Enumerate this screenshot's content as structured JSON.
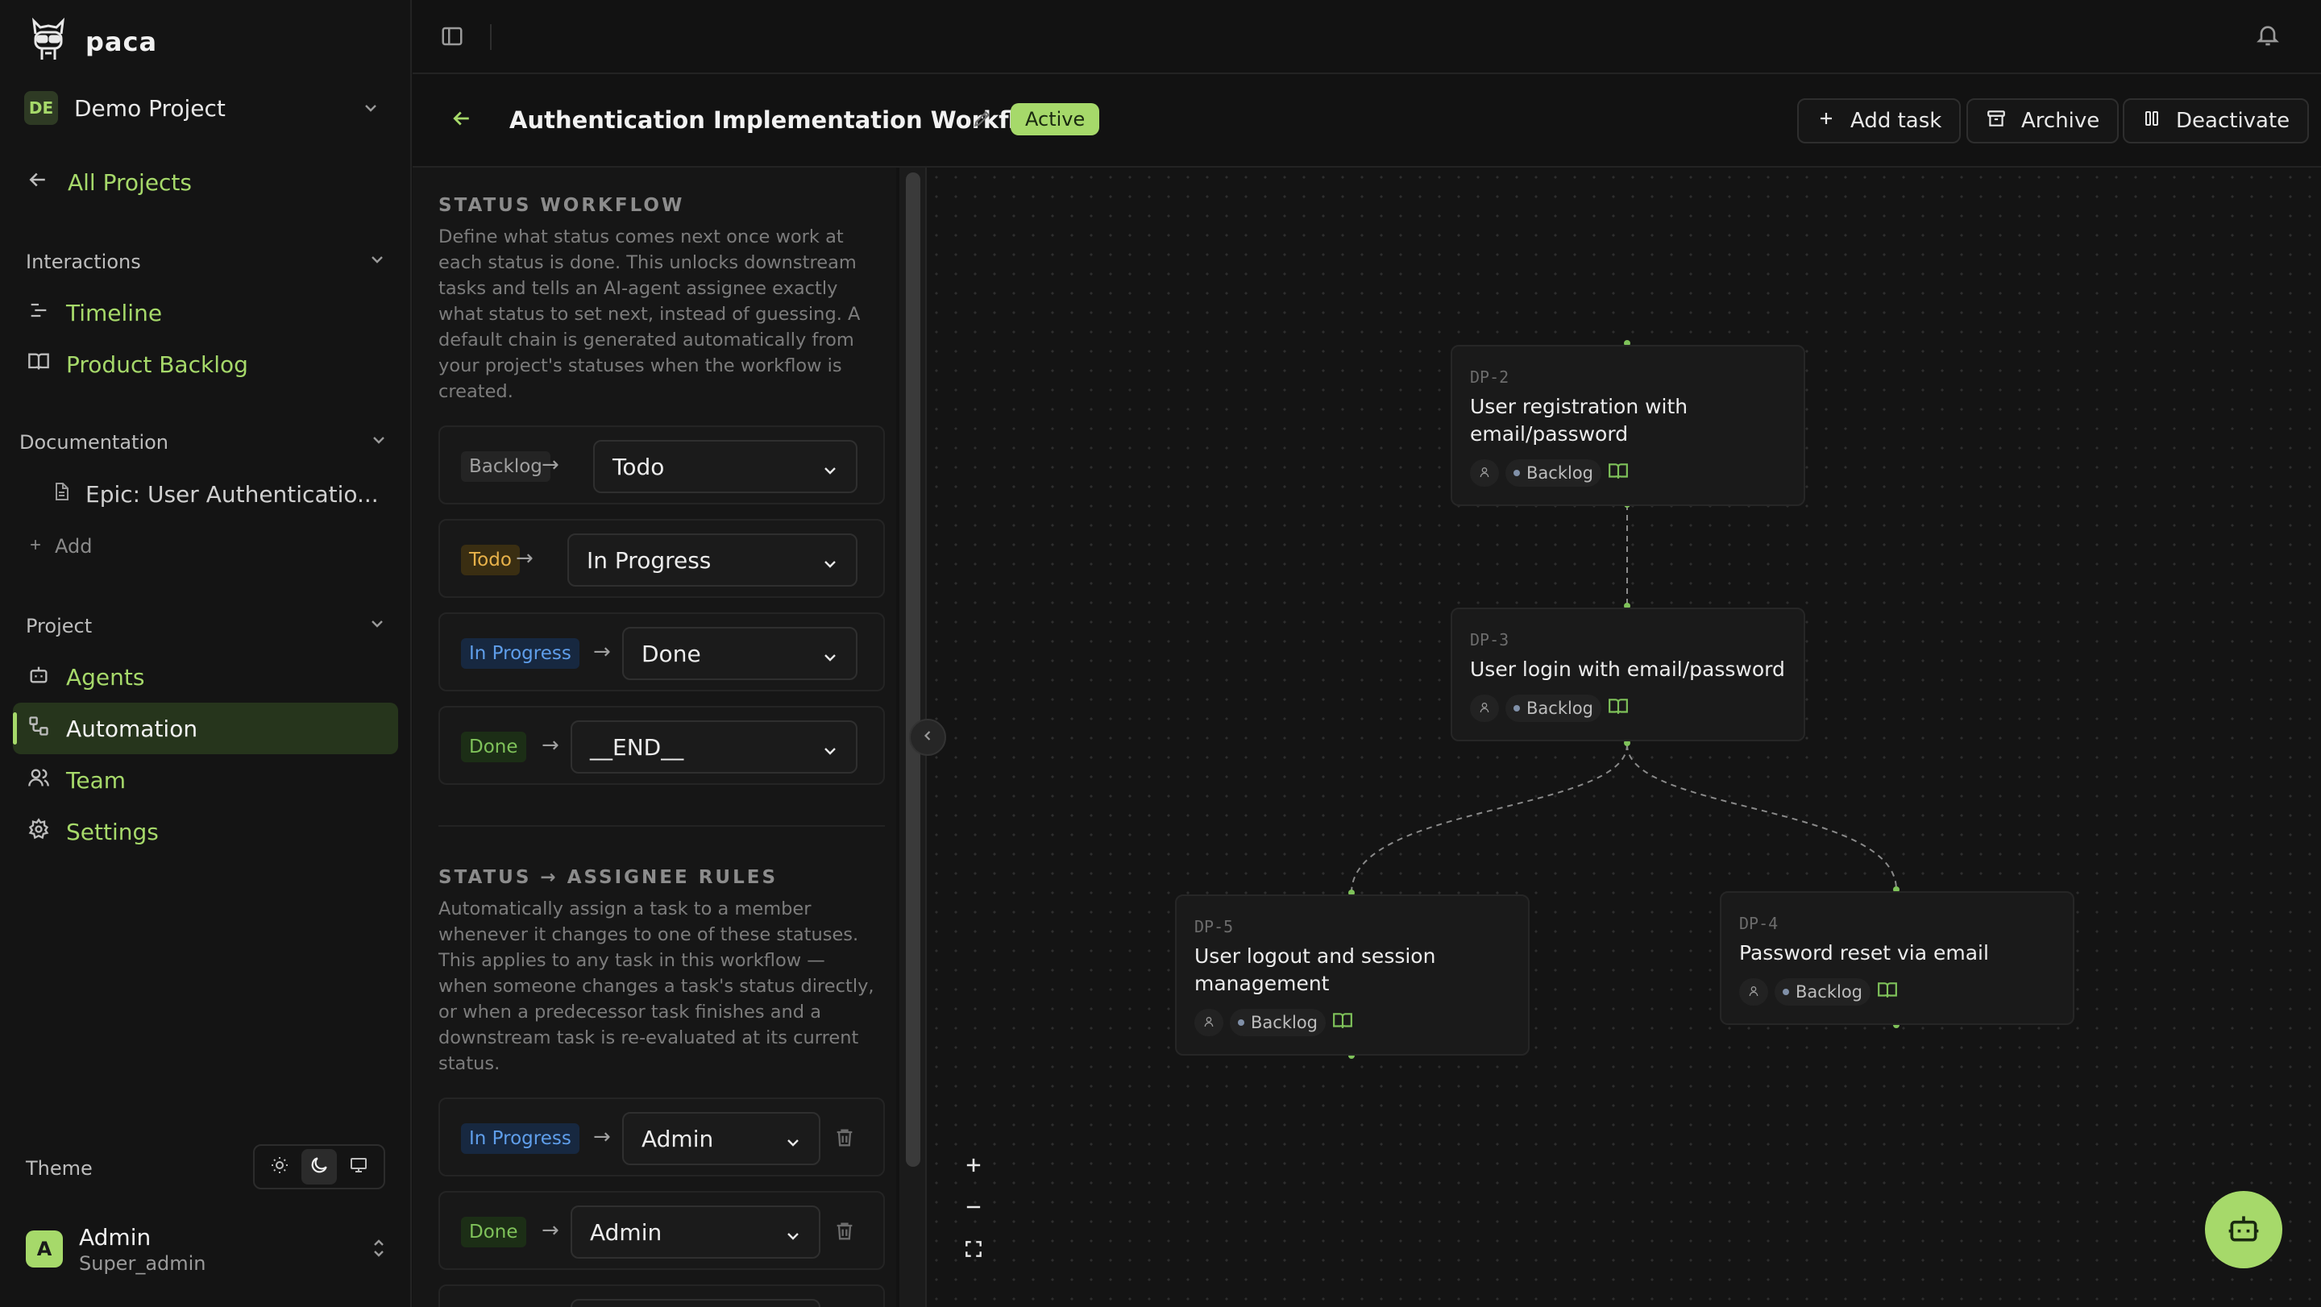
{
  "app": {
    "name": "paca"
  },
  "project": {
    "initials": "DE",
    "name": "Demo Project"
  },
  "nav": {
    "all_projects": "All Projects",
    "interactions_label": "Interactions",
    "timeline": "Timeline",
    "product_backlog": "Product Backlog",
    "documentation_label": "Documentation",
    "doc_item": "Epic: User Authenticatio...",
    "add": "Add",
    "project_label": "Project",
    "agents": "Agents",
    "automation": "Automation",
    "team": "Team",
    "settings": "Settings"
  },
  "theme": {
    "label": "Theme",
    "options": [
      "light",
      "dark",
      "system"
    ],
    "selected": "dark"
  },
  "user": {
    "initial": "A",
    "name": "Admin",
    "role": "Super_admin"
  },
  "header": {
    "title": "Authentication Implementation Workflow",
    "status": "Active",
    "add_task": "Add task",
    "archive": "Archive",
    "deactivate": "Deactivate"
  },
  "status_workflow": {
    "title": "STATUS WORKFLOW",
    "description": "Define what status comes next once work at each status is done. This unlocks downstream tasks and tells an AI-agent assignee exactly what status to set next, instead of guessing. A default chain is generated automatically from your project's statuses when the workflow is created.",
    "rows": [
      {
        "from": "Backlog",
        "to": "Todo"
      },
      {
        "from": "Todo",
        "to": "In Progress"
      },
      {
        "from": "In Progress",
        "to": "Done"
      },
      {
        "from": "Done",
        "to": "__END__"
      }
    ]
  },
  "assignee_rules": {
    "title": "STATUS → ASSIGNEE RULES",
    "description": "Automatically assign a task to a member whenever it changes to one of these statuses. This applies to any task in this workflow — when someone changes a task's status directly, or when a predecessor task finishes and a downstream task is re-evaluated at its current status.",
    "rows": [
      {
        "status": "In Progress",
        "assignee": "Admin"
      },
      {
        "status": "Done",
        "assignee": "Admin"
      }
    ]
  },
  "nodes": [
    {
      "id": "DP-2",
      "title": "User registration with email/password",
      "status": "Backlog"
    },
    {
      "id": "DP-3",
      "title": "User login with email/password",
      "status": "Backlog"
    },
    {
      "id": "DP-5",
      "title": "User logout and session management",
      "status": "Backlog"
    },
    {
      "id": "DP-4",
      "title": "Password reset via email",
      "status": "Backlog"
    }
  ],
  "colors": {
    "accent": "#a6d96a",
    "background": "#121212",
    "todo": "#e8b24a",
    "in_progress": "#5f9eea",
    "done": "#7fc25a"
  }
}
